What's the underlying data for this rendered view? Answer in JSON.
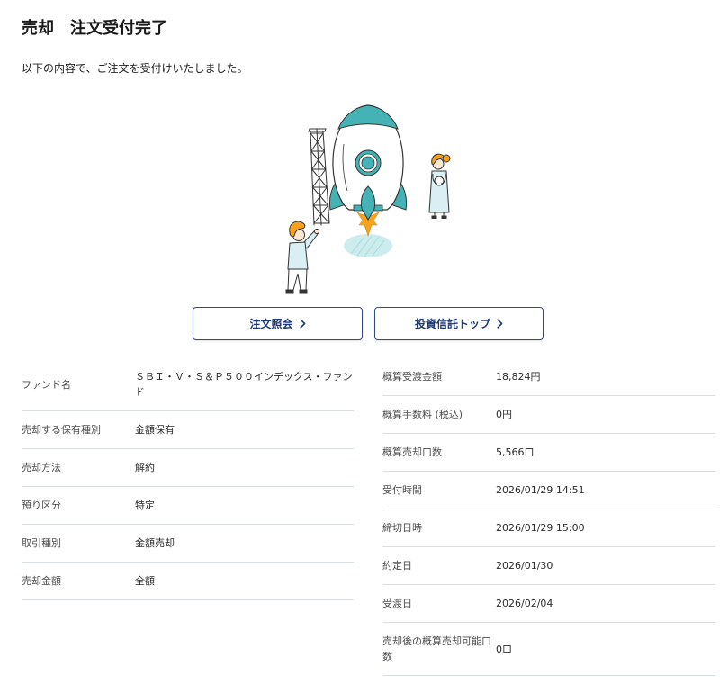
{
  "page": {
    "title": "売却　注文受付完了",
    "message": "以下の内容で、ご注文を受付けいたしました。"
  },
  "actions": {
    "order_inquiry_label": "注文照会",
    "fund_top_label": "投資信託トップ"
  },
  "order_details": [
    {
      "label": "ファンド名",
      "value": "ＳＢＩ・Ｖ・Ｓ＆Ｐ５００インデックス・ファンド"
    },
    {
      "label": "売却する保有種別",
      "value": "金額保有"
    },
    {
      "label": "売却方法",
      "value": "解約"
    },
    {
      "label": "預り区分",
      "value": "特定"
    },
    {
      "label": "取引種別",
      "value": "金額売却"
    },
    {
      "label": "売却金額",
      "value": "全額"
    }
  ],
  "settlement_details": [
    {
      "label": "概算受渡金額",
      "value": "18,824円"
    },
    {
      "label": "概算手数料 (税込)",
      "value": "0円"
    },
    {
      "label": "概算売却口数",
      "value": "5,566口"
    },
    {
      "label": "受付時間",
      "value": "2026/01/29 14:51"
    },
    {
      "label": "締切日時",
      "value": "2026/01/29 15:00"
    },
    {
      "label": "約定日",
      "value": "2026/01/30"
    },
    {
      "label": "受渡日",
      "value": "2026/02/04"
    },
    {
      "label": "売却後の概算売却可能口数",
      "value": "0口"
    }
  ],
  "icons": {
    "illustration": "rocket-launch-illustration",
    "button_chevron": "chevron-right-icon"
  },
  "colors": {
    "accent_navy": "#1f3a78",
    "button_border": "#2f4a8a",
    "illustration_teal": "#45b3b5",
    "illustration_orange": "#f5a21c",
    "shadow_teal": "#ccecee",
    "row_border": "#d9dee4"
  }
}
